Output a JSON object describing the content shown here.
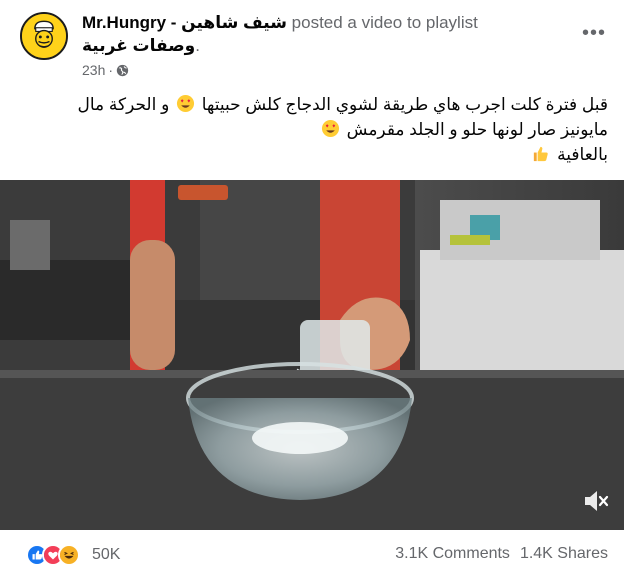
{
  "post": {
    "page_name": "Mr.Hungry",
    "separator": " - ",
    "page_name_arabic": "شيف شاهين",
    "action_text": " posted a video to playlist",
    "playlist_name": "وصفات غربية",
    "playlist_period": ".",
    "time": "23h",
    "time_separator": "·",
    "privacy_icon": "globe-icon",
    "more_icon": "more-icon",
    "caption": {
      "line1_text": "قبل فترة كلت اجرب هاي طريقة لشوي الدجاج كلش حبيتها",
      "line1_tail": "و الحركة مال",
      "line2_text": "مايونيز صار لونها حلو و الجلد مقرمش",
      "line3_text": "بالعافية",
      "emoji_heart_eyes": "heart-eyes-emoji",
      "emoji_thumbs": "thumbs-up-emoji"
    }
  },
  "video": {
    "mute_icon": "muted-speaker-icon"
  },
  "footer": {
    "reaction_icons": [
      "like-icon",
      "love-icon",
      "haha-icon"
    ],
    "reaction_count": "50K",
    "comments": "3.1K Comments",
    "shares": "1.4K Shares"
  },
  "colors": {
    "avatar_bg": "#ffd21a",
    "like_blue": "#1877f2",
    "love_red": "#f33e58",
    "haha_yellow": "#f7b125",
    "secondary_text": "#65676b"
  }
}
